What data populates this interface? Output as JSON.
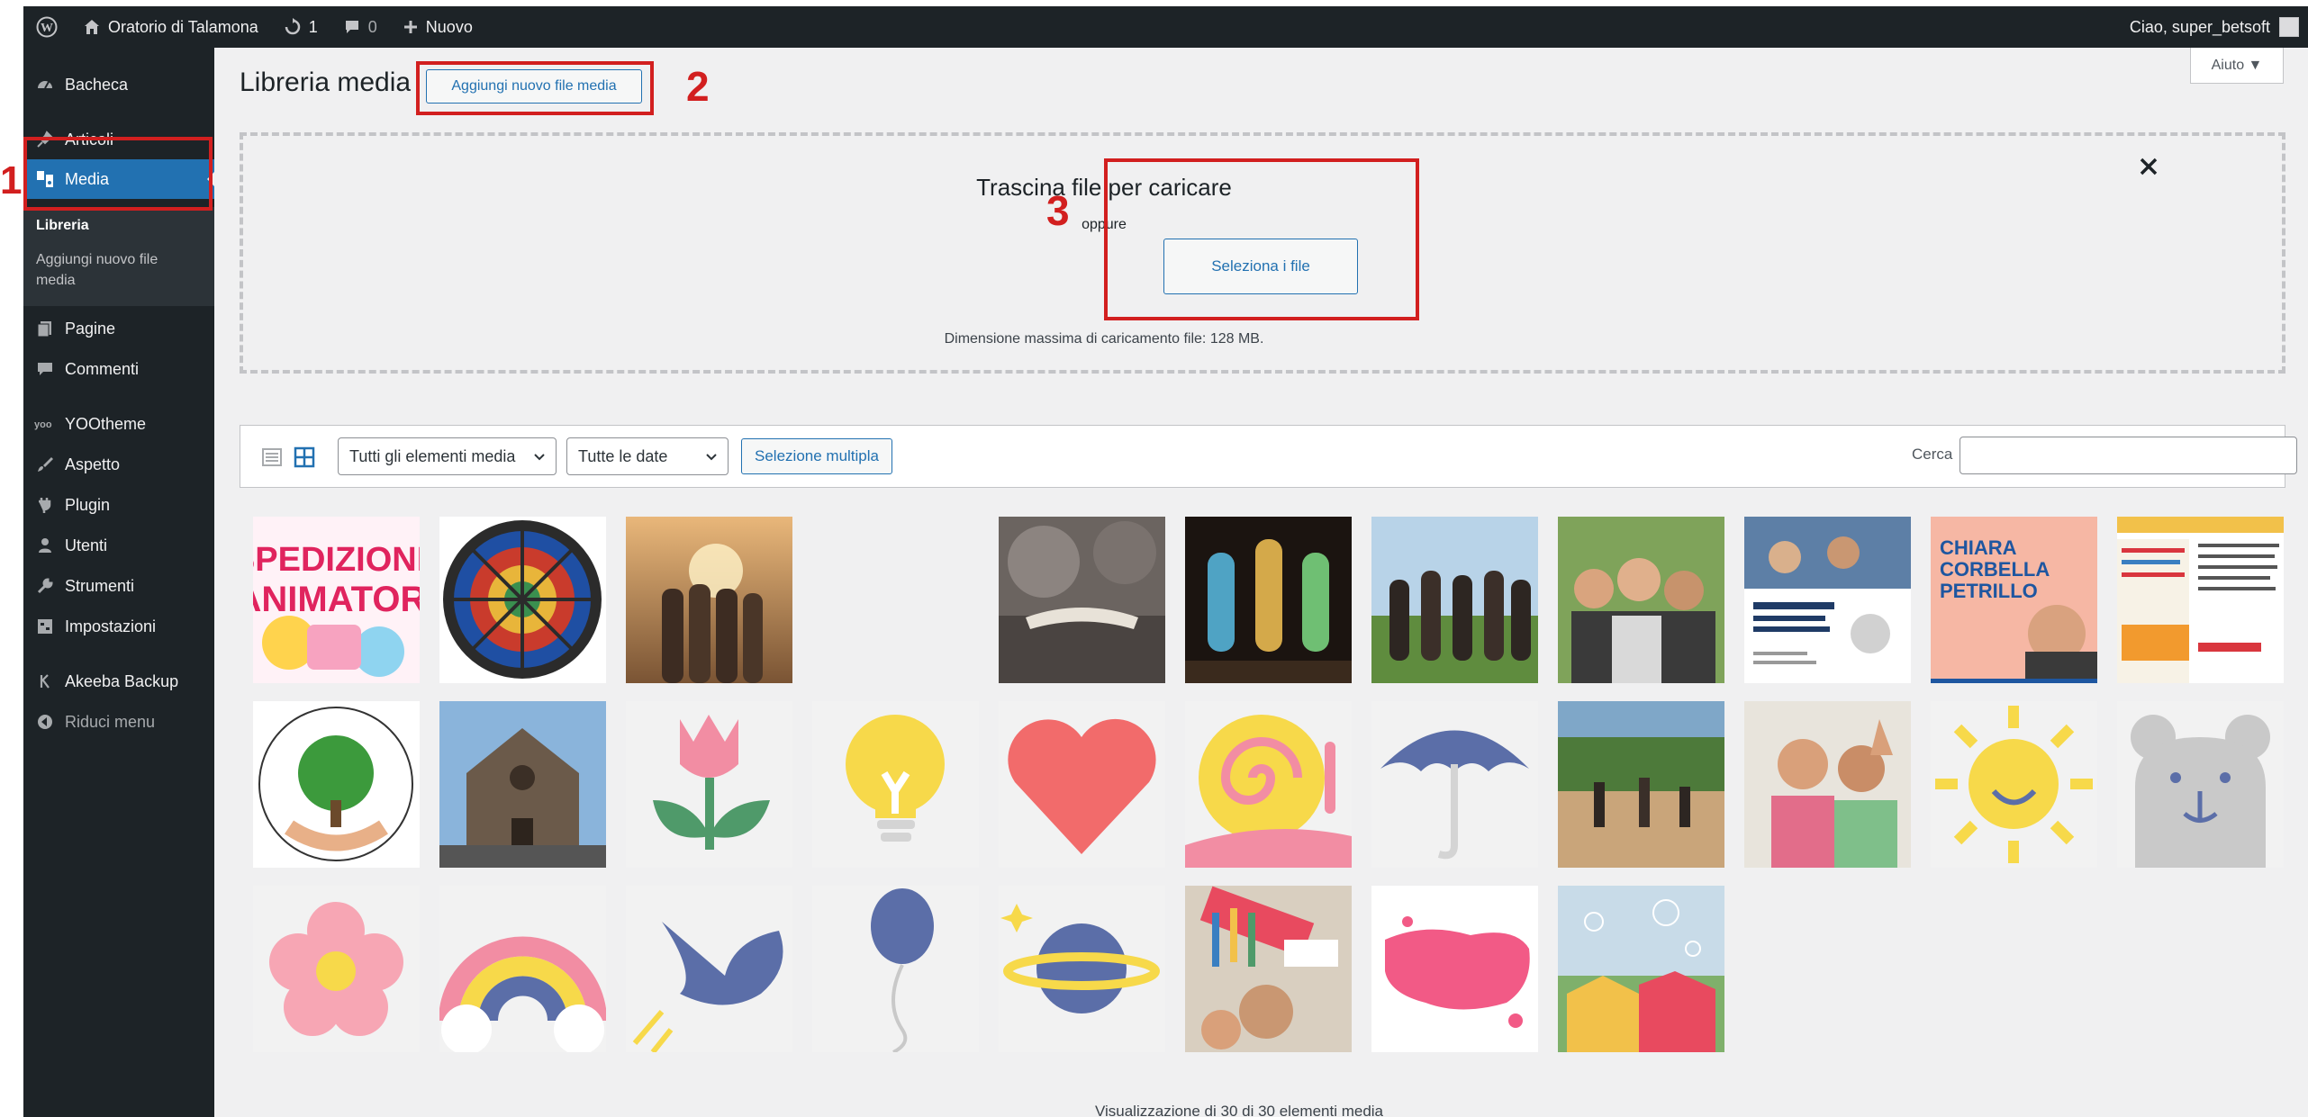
{
  "admin_bar": {
    "site_name": "Oratorio di Talamona",
    "updates_count": "1",
    "comments_count": "0",
    "new_label": "Nuovo",
    "greeting": "Ciao, super_betsoft"
  },
  "sidebar": {
    "items": [
      {
        "label": "Bacheca",
        "icon": "dashboard-icon"
      },
      {
        "label": "Articoli",
        "icon": "pin-icon"
      },
      {
        "label": "Media",
        "icon": "media-icon"
      },
      {
        "label": "Pagine",
        "icon": "pages-icon"
      },
      {
        "label": "Commenti",
        "icon": "comments-icon"
      },
      {
        "label": "YOOtheme",
        "icon": "yootheme-icon"
      },
      {
        "label": "Aspetto",
        "icon": "brush-icon"
      },
      {
        "label": "Plugin",
        "icon": "plugin-icon"
      },
      {
        "label": "Utenti",
        "icon": "users-icon"
      },
      {
        "label": "Strumenti",
        "icon": "wrench-icon"
      },
      {
        "label": "Impostazioni",
        "icon": "settings-icon"
      },
      {
        "label": "Akeeba Backup",
        "icon": "akeeba-icon"
      },
      {
        "label": "Riduci menu",
        "icon": "collapse-icon"
      }
    ],
    "submenu": {
      "library": "Libreria",
      "add_new_line1": "Aggiungi nuovo file",
      "add_new_line2": "media"
    }
  },
  "main": {
    "title": "Libreria media",
    "add_new_button": "Aggiungi nuovo file media",
    "help_tab": "Aiuto ▼"
  },
  "uploader": {
    "drop_title": "Trascina file per caricare",
    "or_text": "oppure",
    "select_button": "Seleziona i file",
    "max_size": "Dimensione massima di caricamento file: 128 MB."
  },
  "toolbar": {
    "filter_type": "Tutti gli elementi media",
    "filter_date": "Tutte le date",
    "bulk_select": "Selezione multipla",
    "search_label": "Cerca",
    "search_value": ""
  },
  "annotations": [
    "1",
    "2",
    "3"
  ],
  "thumbnails": [
    "spedizione-animatori-poster",
    "stained-glass-rose-window",
    "friends-sunset",
    "blank-image",
    "open-book-on-table",
    "church-stained-glass",
    "friends-heart-hands",
    "group-selfie",
    "scholarship-flyer",
    "chiara-corbella-poster",
    "summer-flyer",
    "oratorio-tree-logo",
    "stone-church",
    "pink-tulip",
    "yellow-lightbulb",
    "red-heart",
    "snail",
    "blue-umbrella",
    "beach-volleyball",
    "smiling-boys-hands",
    "yellow-sun",
    "grey-bear",
    "pink-flower",
    "rainbow",
    "blue-bird",
    "blue-balloon",
    "planet",
    "kids-painting",
    "pink-paint-splash",
    "bouncy-castle-bubbles"
  ],
  "footer": {
    "count_text": "Visualizzazione di 30 di 30 elementi media"
  },
  "colors": {
    "admin_dark": "#1d2327",
    "accent_blue": "#2271b1",
    "annotation_red": "#d21f1f",
    "background": "#f0f0f1"
  }
}
